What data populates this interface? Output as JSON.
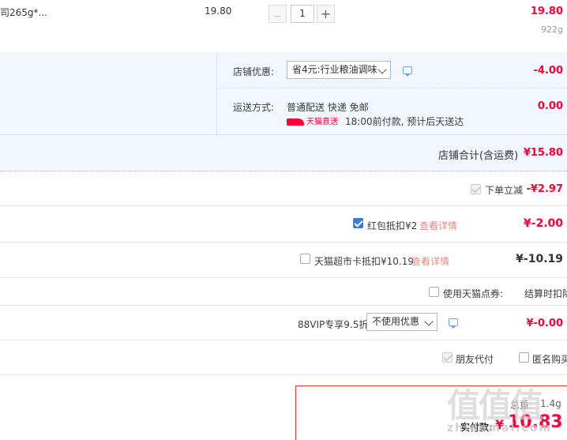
{
  "product": {
    "name": "司265g*...",
    "unit_price": "19.80",
    "quantity": "1",
    "minus_symbol": "—",
    "plus_symbol": "+",
    "subtotal": "19.80",
    "weight": "922g"
  },
  "shop": {
    "discount_label": "店铺优惠:",
    "discount_select": "省4元:行业粮油调味",
    "discount_amount": "-4.00",
    "shipping_label": "运送方式:",
    "shipping_method": "普通配送 快递 免邮",
    "shipping_badge": "天猫直送",
    "shipping_note": "18:00前付款, 预计后天送达",
    "shipping_amount": "0.00",
    "total_label": "店铺合计(含运费)",
    "total_value": "¥15.80"
  },
  "discounts": {
    "instant_label": "下单立减",
    "instant_value": "-¥2.97",
    "redpacket_label": "红包抵扣¥2",
    "redpacket_link": "查看详情",
    "redpacket_value": "¥-2.00",
    "tmallcard_label": "天猫超市卡抵扣¥10.19",
    "tmallcard_link": "查看详情",
    "tmallcard_value": "¥-10.19",
    "points_label": "使用天猫点券:",
    "points_note": "结算时扣除",
    "vip_label": "88VIP专享9.5折",
    "vip_select": "不使用优惠",
    "vip_value": "¥-0.00",
    "friend_pay": "朋友代付",
    "anonymous": "匿名购买"
  },
  "final": {
    "weight_label": "总重:",
    "weight_value": "1.4g",
    "pay_label": "实付款:",
    "currency": "¥",
    "amount": "10.83"
  },
  "colors": {
    "price_red": "#ff0036",
    "shop_bg": "#f2f7ff",
    "checkbox_blue": "#3a7bd5"
  },
  "icons": {
    "chat": "chat-bubble-icon",
    "chevron": "chevron-down-icon",
    "tmall": "tmall-logo-icon"
  },
  "watermark": {
    "logo": "值值值",
    "domain": "zhidemai.com"
  }
}
